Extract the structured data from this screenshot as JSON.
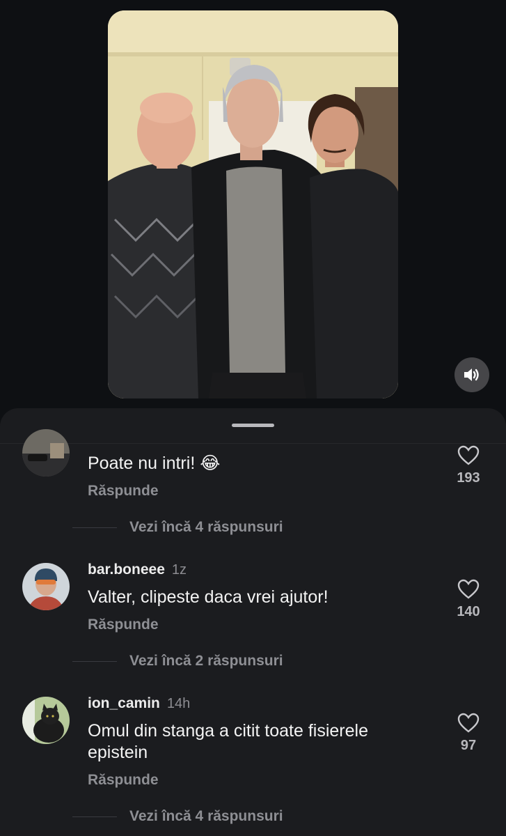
{
  "comments": [
    {
      "username": "",
      "time": "",
      "text": "Poate nu intri! 😂",
      "reply_label": "Răspunde",
      "likes": "193",
      "more_replies": "Vezi încă 4 răspunsuri"
    },
    {
      "username": "bar.boneee",
      "time": "1z",
      "text": "Valter, clipeste daca vrei ajutor!",
      "reply_label": "Răspunde",
      "likes": "140",
      "more_replies": "Vezi încă 2 răspunsuri"
    },
    {
      "username": "ion_camin",
      "time": "14h",
      "text": "Omul din stanga a citit toate fisierele epistein",
      "reply_label": "Răspunde",
      "likes": "97",
      "more_replies": "Vezi încă 4 răspunsuri"
    }
  ],
  "icons": {
    "sound": "speaker-icon",
    "like": "heart-icon"
  },
  "colors": {
    "sheet": "#1b1c1f",
    "background": "#0e1013",
    "muted_text": "#8e8f94"
  }
}
